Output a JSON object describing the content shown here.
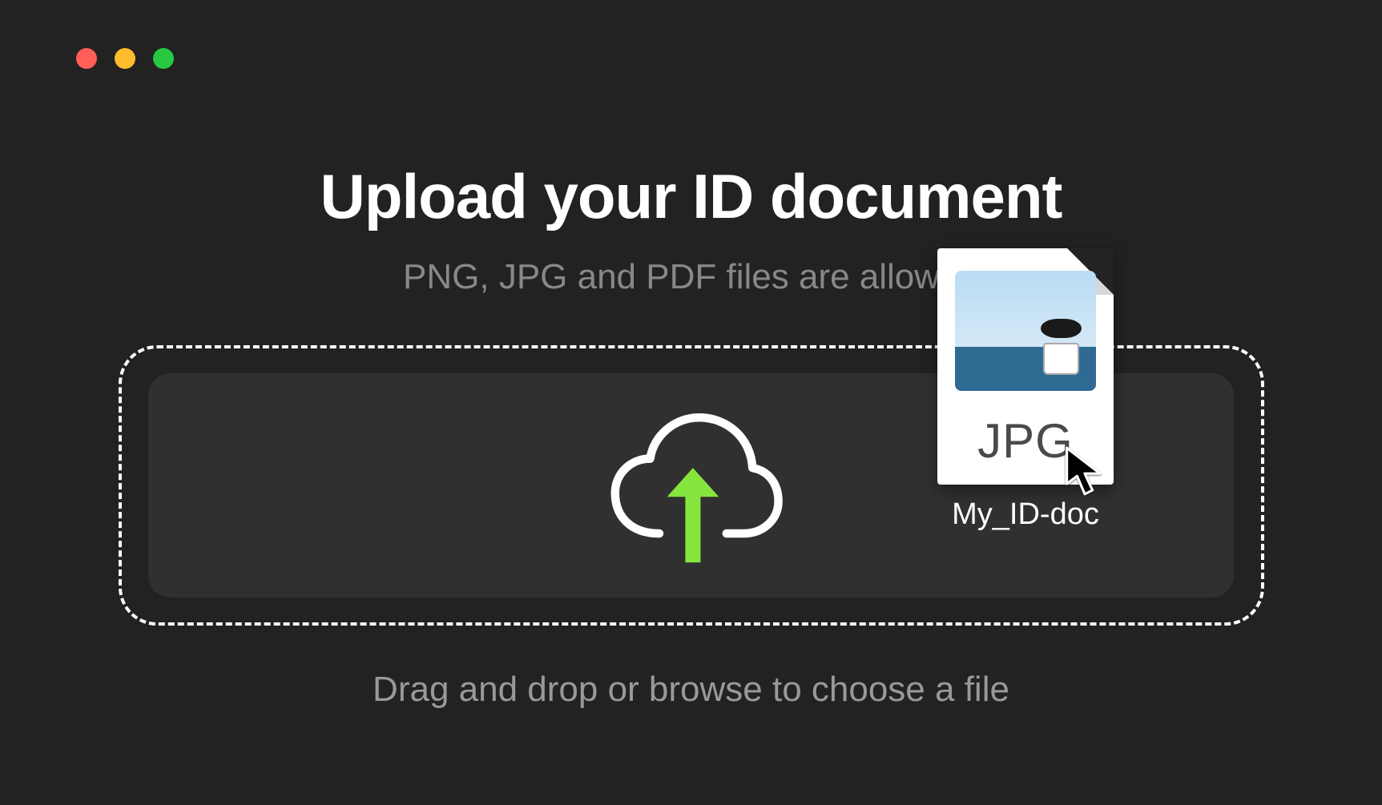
{
  "colors": {
    "background": "#222222",
    "text_primary": "#ffffff",
    "text_secondary": "#888888",
    "dropzone_border": "#ffffff",
    "dropzone_fill": "#303030",
    "arrow_accent": "#86e53c"
  },
  "traffic_lights": {
    "red": "#ff5f57",
    "yellow": "#febc2e",
    "green": "#28c840"
  },
  "upload": {
    "title": "Upload your ID document",
    "subtitle": "PNG, JPG and PDF files are allowed",
    "instruction": "Drag and drop or browse to choose a file",
    "icon": "cloud-upload-icon"
  },
  "dragging_file": {
    "name": "My_ID-doc",
    "extension_label": "JPG",
    "thumbnail_icon": "photo-thumbnail-icon"
  },
  "cursor_icon": "mouse-cursor-icon"
}
